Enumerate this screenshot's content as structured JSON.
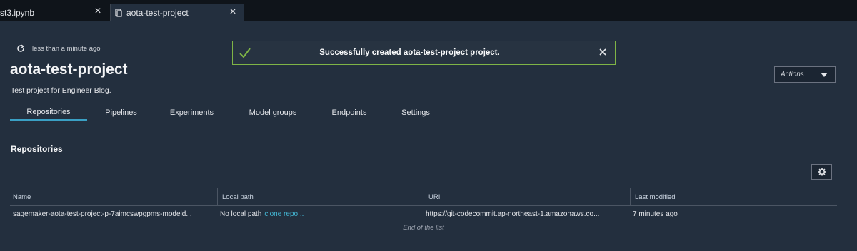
{
  "tabs": [
    {
      "label": "st3.ipynb"
    },
    {
      "label": "aota-test-project"
    }
  ],
  "header": {
    "refresh_text": "less than a minute ago",
    "title": "aota-test-project",
    "description": "Test project for Engineer Blog."
  },
  "flash": {
    "message": "Successfully created aota-test-project project."
  },
  "actions": {
    "label": "Actions"
  },
  "nav": {
    "items": [
      "Repositories",
      "Pipelines",
      "Experiments",
      "Model groups",
      "Endpoints",
      "Settings"
    ],
    "selected": "Repositories"
  },
  "repositories": {
    "title": "Repositories",
    "columns": [
      "Name",
      "Local path",
      "URI",
      "Last modified"
    ],
    "rows": [
      {
        "name": "sagemaker-aota-test-project-p-7aimcswpgpms-modeld...",
        "local_path": "No local path",
        "local_path_link": "clone repo...",
        "uri": "https://git-codecommit.ap-northeast-1.amazonaws.co...",
        "last_modified": "7 minutes ago"
      }
    ],
    "footer": "End of the list"
  },
  "colors": {
    "background": "#232f3e",
    "success_border": "#7fb446",
    "link": "#44b9d6",
    "tab_underline": "#3aa0c4"
  }
}
